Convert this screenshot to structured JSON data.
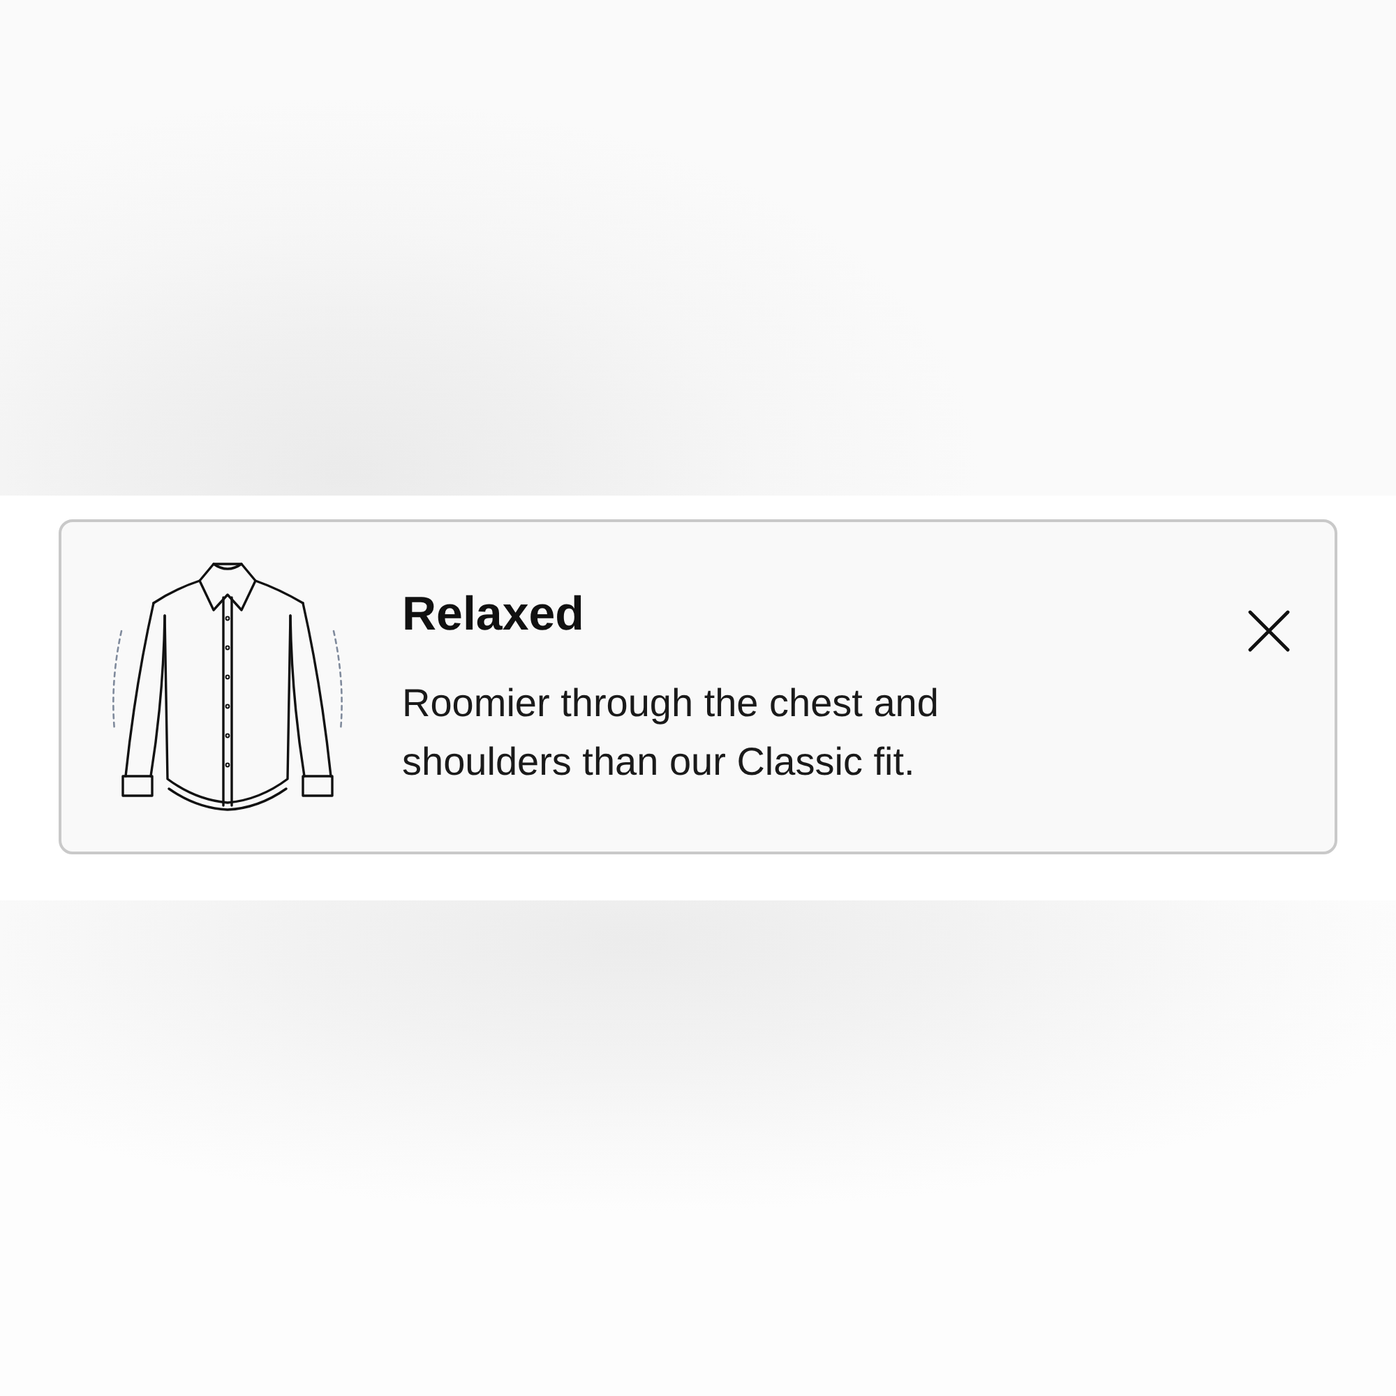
{
  "fit_card": {
    "title": "Relaxed",
    "description": "Roomier through the chest and shoulders than our Classic fit."
  }
}
